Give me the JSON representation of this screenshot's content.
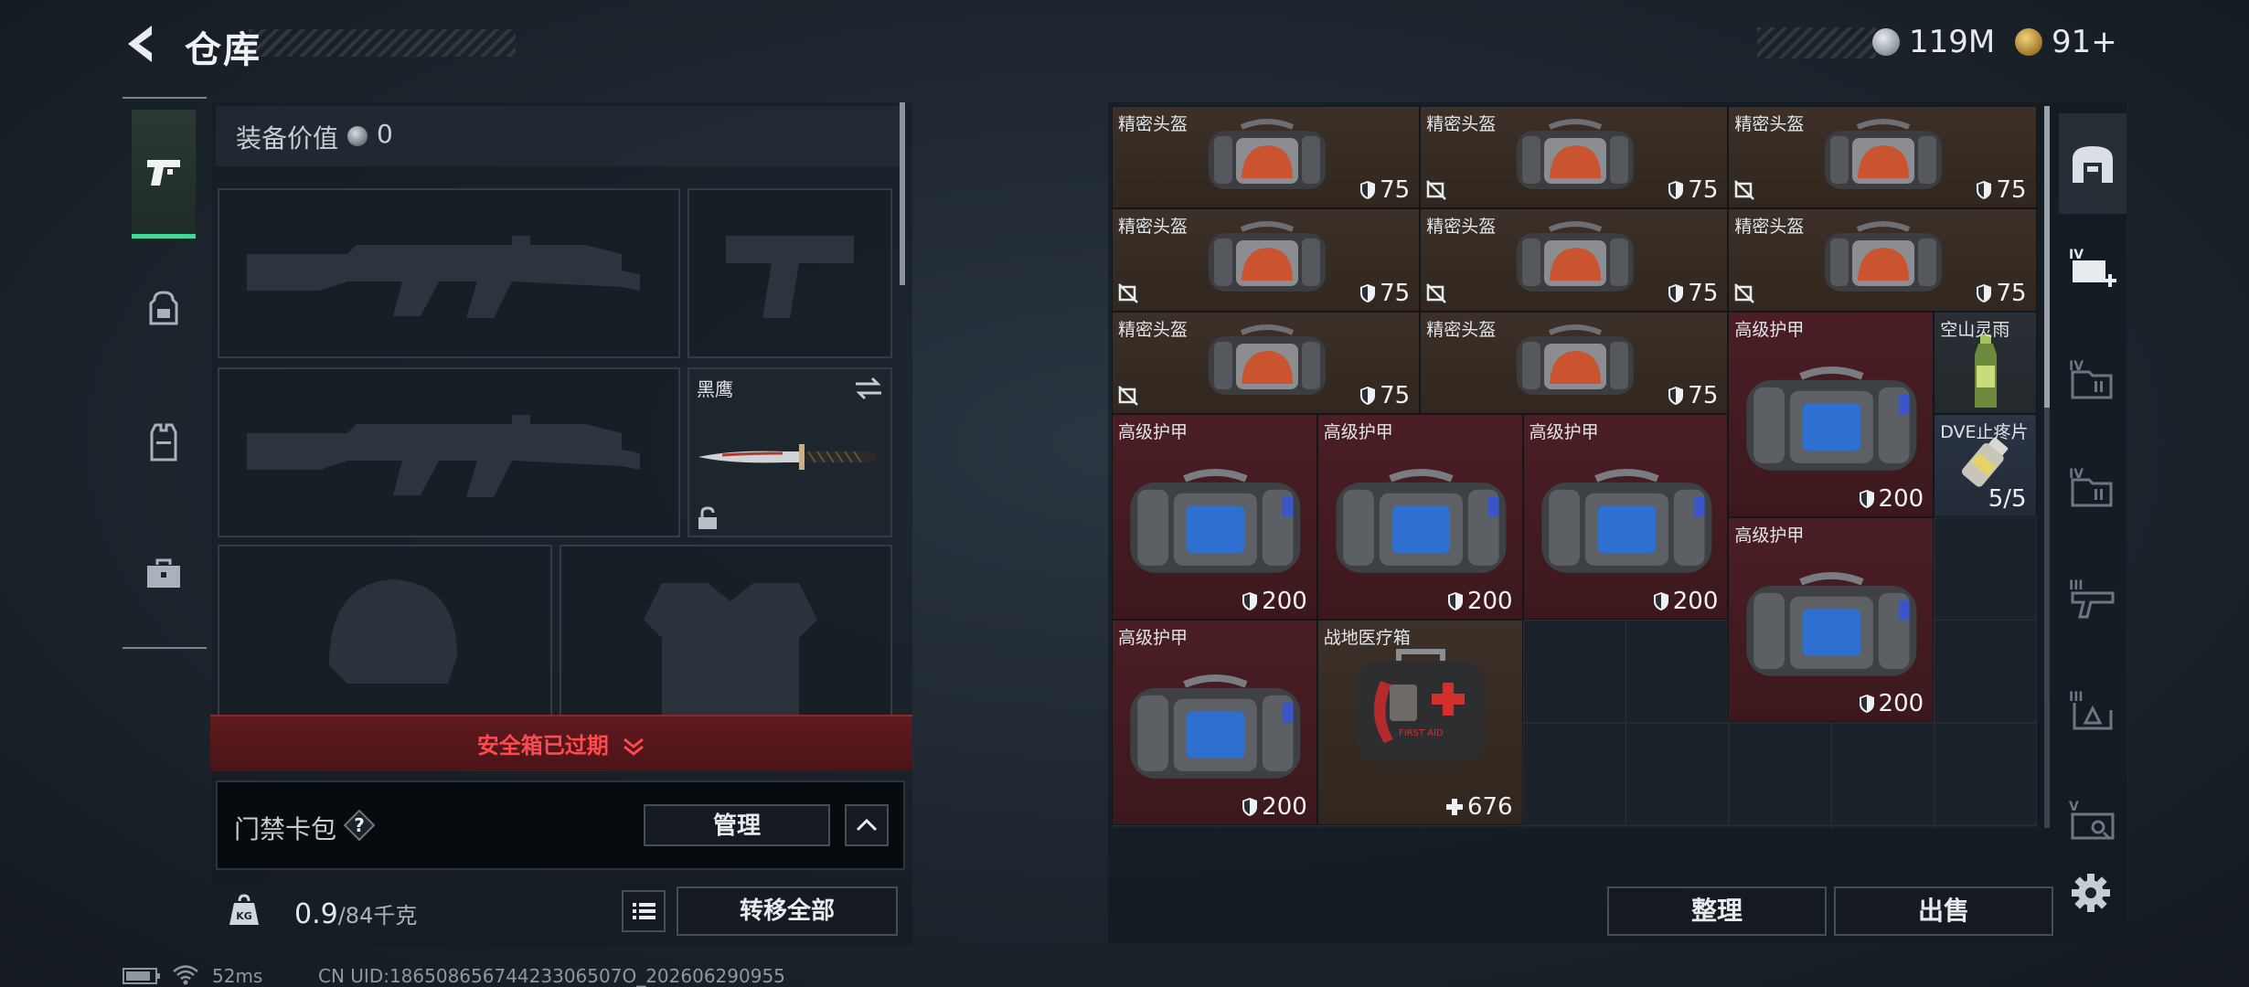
{
  "header": {
    "title": "仓库",
    "currency": [
      {
        "icon": "silver-coin-icon",
        "value": "119M"
      },
      {
        "icon": "gold-coin-icon",
        "value": "91+"
      }
    ]
  },
  "left_tabs": [
    {
      "icon": "pistol-icon",
      "active": true
    },
    {
      "icon": "backpack-icon",
      "active": false
    },
    {
      "icon": "vest-icon",
      "active": false
    },
    {
      "icon": "toolbox-icon",
      "active": false
    }
  ],
  "loadout": {
    "equipment_value_label": "装备价值",
    "equipment_value": "0",
    "melee_name": "黑鹰",
    "expired_notice": "安全箱已过期",
    "keycard_label": "门禁卡包",
    "help_mark": "?",
    "manage_label": "管理",
    "weight_value": "0.9",
    "weight_max": "/84千克",
    "transfer_all_label": "转移全部"
  },
  "status_bar": {
    "ping": "52ms",
    "uid": "CN UID:18650865674423306507O_202606290955"
  },
  "storage_items": [
    {
      "name": "精密头盔",
      "value": "75",
      "type": "helmet",
      "tint": "brown",
      "noflag": false
    },
    {
      "name": "精密头盔",
      "value": "75",
      "type": "helmet",
      "tint": "brown",
      "noflag": true
    },
    {
      "name": "精密头盔",
      "value": "75",
      "type": "helmet",
      "tint": "brown",
      "noflag": true
    },
    {
      "name": "精密头盔",
      "value": "75",
      "type": "helmet",
      "tint": "brown",
      "noflag": true
    },
    {
      "name": "精密头盔",
      "value": "75",
      "type": "helmet",
      "tint": "brown",
      "noflag": true
    },
    {
      "name": "精密头盔",
      "value": "75",
      "type": "helmet",
      "tint": "brown",
      "noflag": true
    },
    {
      "name": "精密头盔",
      "value": "75",
      "type": "helmet",
      "tint": "brown",
      "noflag": true
    },
    {
      "name": "精密头盔",
      "value": "75",
      "type": "helmet",
      "tint": "brown",
      "noflag": false
    },
    {
      "name": "高级护甲",
      "value": "200",
      "type": "armor",
      "tint": "red",
      "noflag": false
    },
    {
      "name": "空山灵雨",
      "value": "",
      "type": "drink",
      "tint": "dark",
      "noflag": false
    },
    {
      "name": "DVE止疼片",
      "value": "5/5",
      "type": "pill",
      "tint": "blue",
      "noflag": false
    },
    {
      "name": "高级护甲",
      "value": "200",
      "type": "armor",
      "tint": "red",
      "noflag": false
    },
    {
      "name": "高级护甲",
      "value": "200",
      "type": "armor",
      "tint": "red",
      "noflag": false
    },
    {
      "name": "高级护甲",
      "value": "200",
      "type": "armor",
      "tint": "red",
      "noflag": false
    },
    {
      "name": "高级护甲",
      "value": "200",
      "type": "armor",
      "tint": "red",
      "noflag": false
    },
    {
      "name": "高级护甲",
      "value": "200",
      "type": "armor",
      "tint": "red",
      "noflag": false
    },
    {
      "name": "战地医疗箱",
      "value": "676",
      "type": "medkit",
      "tint": "brown",
      "noflag": false,
      "medkit_label": "FIRST AID"
    }
  ],
  "storage_actions": {
    "sort_label": "整理",
    "sell_label": "出售"
  },
  "right_tabs": [
    {
      "icon": "main-storage-icon",
      "badge": ""
    },
    {
      "icon": "add-storage-icon",
      "badge": "IV"
    },
    {
      "icon": "storage-iv-icon",
      "badge": "IV"
    },
    {
      "icon": "storage-iv-b-icon",
      "badge": "IV"
    },
    {
      "icon": "storage-iii-icon",
      "badge": "III"
    },
    {
      "icon": "storage-iii-b-icon",
      "badge": "III"
    },
    {
      "icon": "storage-v-icon",
      "badge": "V"
    }
  ],
  "colors": {
    "accent_green": "#43d79a",
    "warning_red": "#ff4a4f",
    "item_brown": "#3c3028",
    "item_red": "#4a1e24"
  }
}
